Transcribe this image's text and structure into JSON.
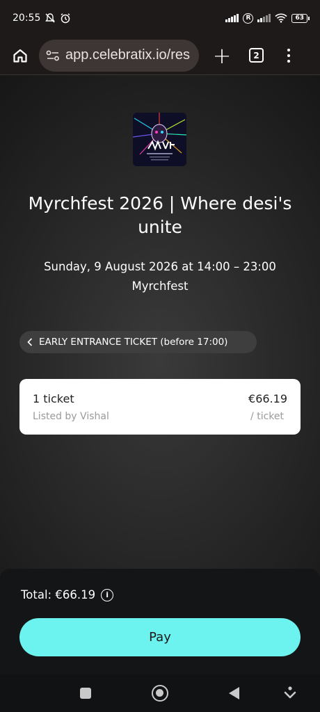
{
  "status_bar": {
    "time": "20:55",
    "r_badge": "R",
    "battery": "63"
  },
  "browser": {
    "url": "app.celebratix.io/res",
    "tab_count": "2",
    "new_tab_symbol": "+"
  },
  "event": {
    "title": "Myrchfest 2026 | Where desi's unite",
    "datetime": "Sunday, 9 August 2026 at 14:00 – 23:00",
    "venue": "Myrchfest",
    "ticket_type": "EARLY ENTRANCE TICKET (before 17:00)"
  },
  "listing": {
    "quantity": "1 ticket",
    "seller": "Listed by Vishal",
    "price": "€66.19",
    "unit": "/ ticket"
  },
  "checkout": {
    "total": "Total: €66.19",
    "pay_label": "Pay",
    "accent_color": "#6cf2ef"
  },
  "icons": {
    "status": [
      "mute-icon",
      "alarm-icon",
      "signal-icon",
      "roaming-icon",
      "wifi-icon",
      "battery-icon"
    ],
    "browser": [
      "home-icon",
      "site-settings-icon",
      "new-tab-icon",
      "tab-switcher-icon",
      "menu-icon"
    ],
    "nav": [
      "recents-icon",
      "home-nav-icon",
      "back-icon",
      "keyboard-hide-icon"
    ]
  }
}
